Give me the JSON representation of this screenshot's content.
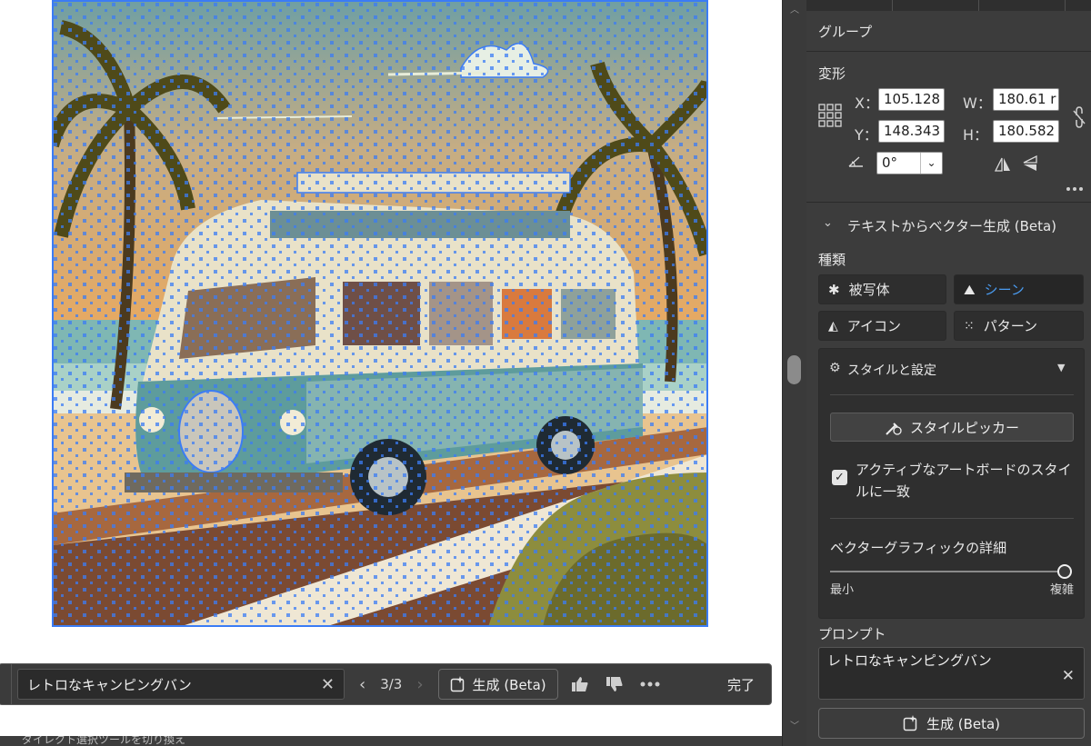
{
  "canvas": {
    "artwork_description_icon": "retro-camper-van-vector-art"
  },
  "taskbar": {
    "prompt_value": "レトロなキャンピングバン",
    "clear_icon": "close-icon",
    "counter": "3/3",
    "generate_label": "生成 (Beta)",
    "done_label": "完了"
  },
  "status": {
    "text": "ダイレクト選択ツールを切り換え"
  },
  "panel": {
    "group_label": "グループ",
    "transform_title": "変形",
    "x_label": "X：",
    "x_value": "105.128",
    "y_label": "Y：",
    "y_value": "148.343",
    "w_label": "W：",
    "w_value": "180.61 r",
    "h_label": "H：",
    "h_value": "180.582",
    "angle_value": "0°",
    "t2v_title": "テキストからベクター生成 (Beta)",
    "kind_label": "種類",
    "types": [
      {
        "label": "被写体",
        "active": false
      },
      {
        "label": "シーン",
        "active": true
      },
      {
        "label": "アイコン",
        "active": false
      },
      {
        "label": "パターン",
        "active": false
      }
    ],
    "style_settings_title": "スタイルと設定",
    "style_picker_label": "スタイルピッカー",
    "checkbox_checked": true,
    "checkbox_label": "アクティブなアートボードのスタイルに一致",
    "detail_label": "ベクターグラフィックの詳細",
    "slider_min": "最小",
    "slider_max": "複雑",
    "slider_value": 1.0,
    "prompt_title": "プロンプト",
    "prompt_value": "レトロなキャンピングバン",
    "generate_label": "生成 (Beta)"
  },
  "colors": {
    "panel_bg": "#3c3c3c",
    "accent": "#4a9bf0",
    "selection": "#3b7cf5"
  }
}
